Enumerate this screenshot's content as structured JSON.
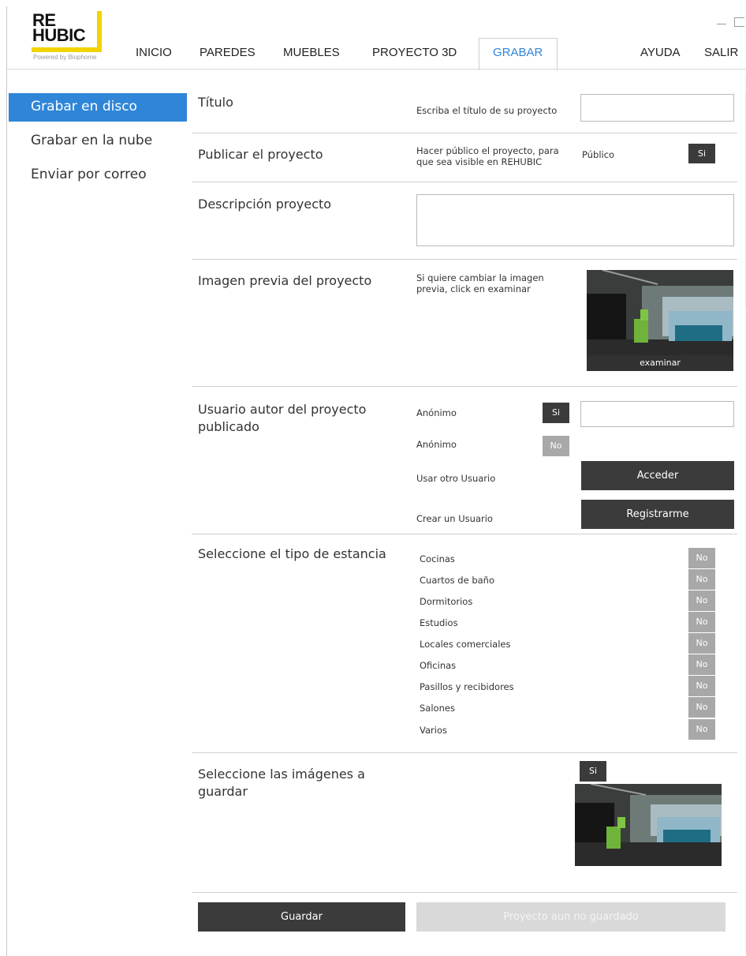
{
  "logo": {
    "line1": "RE",
    "line2": "HUBIC",
    "powered": "Powered by Biophome"
  },
  "nav": {
    "items": [
      "INICIO",
      "PAREDES",
      "MUEBLES",
      "PROYECTO 3D",
      "GRABAR",
      "AYUDA",
      "SALIR"
    ],
    "active": "GRABAR",
    "accent_color": "#2f86d8"
  },
  "sidebar": {
    "items": [
      "Grabar en disco",
      "Grabar en la nube",
      "Enviar por correo"
    ],
    "active": "Grabar en disco"
  },
  "titulo": {
    "label": "Título",
    "hint": "Escriba el título de su proyecto",
    "value": ""
  },
  "publicar": {
    "label": "Publicar el proyecto",
    "hint_line1": "Hacer público el proyecto, para",
    "hint_line2": "que sea visible en REHUBIC",
    "public_label": "Público",
    "toggle": "Si"
  },
  "descripcion": {
    "label": "Descripción proyecto",
    "value": ""
  },
  "imagen": {
    "label": "Imagen previa del proyecto",
    "hint_line1": "Si quiere cambiar la imagen",
    "hint_line2": "previa, click en examinar",
    "examinar": "examinar"
  },
  "usuario": {
    "label_line1": "Usuario autor del proyecto",
    "label_line2": "publicado",
    "anonimo_si_label": "Anónimo",
    "anonimo_si_toggle": "Si",
    "anonimo_no_label": "Anónimo",
    "anonimo_no_toggle": "No",
    "otro_label": "Usar otro Usuario",
    "acceder": "Acceder",
    "crear_label": "Crear un Usuario",
    "registrarme": "Registrarme",
    "user_value": ""
  },
  "estancia": {
    "label": "Seleccione el tipo de estancia",
    "items": [
      {
        "name": "Cocinas",
        "toggle": "No"
      },
      {
        "name": "Cuartos de baño",
        "toggle": "No"
      },
      {
        "name": "Dormitorios",
        "toggle": "No"
      },
      {
        "name": "Estudios",
        "toggle": "No"
      },
      {
        "name": "Locales comerciales",
        "toggle": "No"
      },
      {
        "name": "Oficinas",
        "toggle": "No"
      },
      {
        "name": "Pasillos y recibidores",
        "toggle": "No"
      },
      {
        "name": "Salones",
        "toggle": "No"
      },
      {
        "name": "Varios",
        "toggle": "No"
      }
    ]
  },
  "imagenes": {
    "label_line1": "Seleccione las imágenes a",
    "label_line2": "guardar",
    "toggle": "Si"
  },
  "footer": {
    "guardar": "Guardar",
    "status": "Proyecto aun no guardado"
  }
}
